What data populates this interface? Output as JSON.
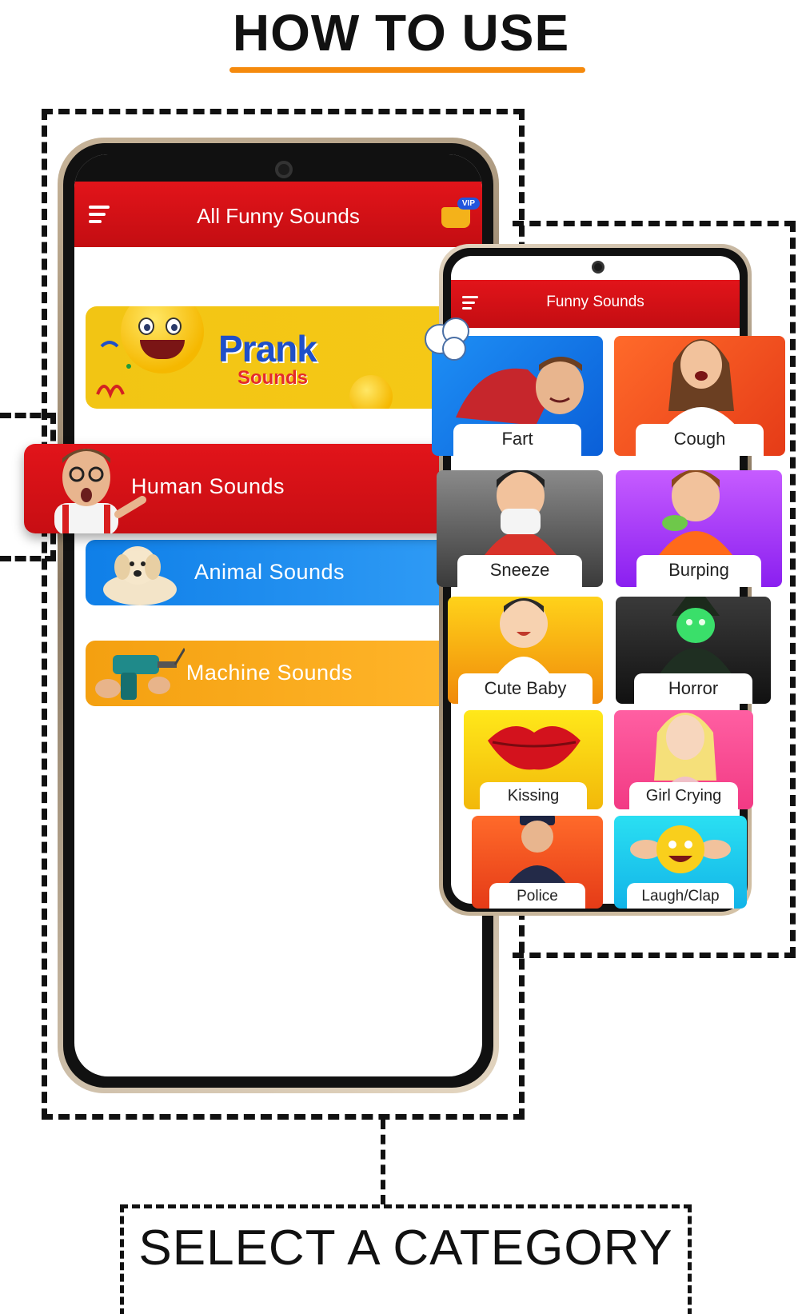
{
  "headline": "HOW TO USE",
  "footer_label": "SELECT A CATEGORY",
  "colors": {
    "accent": "#f58a0d",
    "header_red": "#e2141a",
    "banner_yellow": "#f2c514"
  },
  "main_screen": {
    "title": "All Funny Sounds",
    "menu_icon": "hamburger-menu-icon",
    "vip_badge": "VIP",
    "banner": {
      "title": "Prank",
      "subtitle": "Sounds"
    },
    "categories": [
      {
        "label": "Human Sounds",
        "icon": "surprised-man-image"
      },
      {
        "label": "Animal Sounds",
        "icon": "dog-image"
      },
      {
        "label": "Machine Sounds",
        "icon": "drill-image"
      }
    ]
  },
  "sub_screen": {
    "title": "Funny Sounds",
    "menu_icon": "hamburger-menu-icon",
    "tiles": [
      {
        "label": "Fart"
      },
      {
        "label": "Cough"
      },
      {
        "label": "Sneeze"
      },
      {
        "label": "Burping"
      },
      {
        "label": "Cute Baby"
      },
      {
        "label": "Horror"
      },
      {
        "label": "Kissing"
      },
      {
        "label": "Girl Crying"
      },
      {
        "label": "Police"
      },
      {
        "label": "Laugh/Clap"
      }
    ]
  }
}
